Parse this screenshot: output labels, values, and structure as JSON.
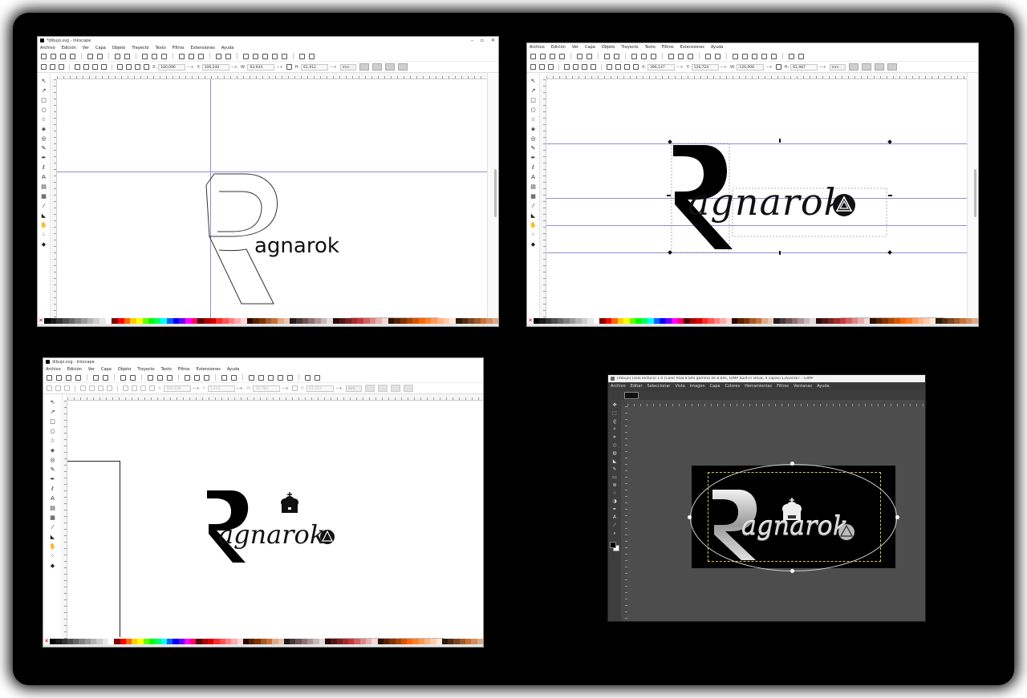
{
  "inkscape": {
    "window_title": "*dibujo.svg - Inkscape",
    "window_title_short": "dibujo.svg - Inkscape",
    "menu": [
      "Archivo",
      "Edición",
      "Ver",
      "Capa",
      "Objeto",
      "Trayecto",
      "Texto",
      "Filtros",
      "Extensiones",
      "Ayuda"
    ],
    "panel1": {
      "x": "180,096",
      "y": "106,246",
      "w": "93,934",
      "h": "61,912",
      "unit": "mm",
      "text": "agnarok"
    },
    "panel2": {
      "x": "396,147",
      "y": "126,724",
      "w": "126,908",
      "h": "61,987",
      "unit": "mm",
      "text_big": "R",
      "text": "agnarok"
    },
    "panel3": {
      "x": "402,834",
      "y": "3,413",
      "w": "35,784",
      "h": "61,412",
      "unit": "mm",
      "text_big": "R",
      "text": "agnarok"
    }
  },
  "gimp": {
    "window_title": "[dibujo] (sólo lectura)-1.0 (Color RGB 8 bits gamma de 8 bits, GIMP built-in sRGB, 4 capas) 1283x587 – GIMP",
    "menu": [
      "Archivo",
      "Editar",
      "Seleccionar",
      "Vista",
      "Imagen",
      "Capa",
      "Colores",
      "Herramientas",
      "Filtros",
      "Ventanas",
      "Ayuda"
    ],
    "text_big": "R",
    "text": "agnarok"
  },
  "palette_colors": [
    "#000000",
    "#1a1a1a",
    "#333333",
    "#4d4d4d",
    "#666666",
    "#808080",
    "#999999",
    "#b3b3b3",
    "#cccccc",
    "#e6e6e6",
    "#ffffff",
    "#800000",
    "#ff0000",
    "#ff6600",
    "#ffcc00",
    "#ffff00",
    "#66ff00",
    "#00ff00",
    "#00ff66",
    "#00ffff",
    "#0066ff",
    "#0000ff",
    "#6600ff",
    "#ff00ff",
    "#ff0066",
    "#550000",
    "#aa0000",
    "#d40000",
    "#ff2a2a",
    "#ff5555",
    "#ff8080",
    "#ffaaaa",
    "#ffd5d5",
    "#2b0000",
    "#552200",
    "#803300",
    "#a05a2c",
    "#c87137",
    "#deaa87",
    "#e9c6af",
    "#241c1c",
    "#483737",
    "#6c5353",
    "#916f6f",
    "#ac9393",
    "#c8b7b7",
    "#e3dbdb",
    "#280b0b",
    "#501616",
    "#782121",
    "#a02c2c",
    "#c83737",
    "#d35f5f",
    "#de8787",
    "#e9afaf",
    "#f4d7d7",
    "#2b1100",
    "#552200",
    "#803300",
    "#aa4400",
    "#d45500",
    "#ff6600",
    "#ff7f2a",
    "#ff9955",
    "#ffb380",
    "#ffccaa",
    "#ffe6d5",
    "#281a0b",
    "#502d16",
    "#784421",
    "#a05a2c",
    "#c87137",
    "#d38d5f",
    "#deaa87"
  ]
}
